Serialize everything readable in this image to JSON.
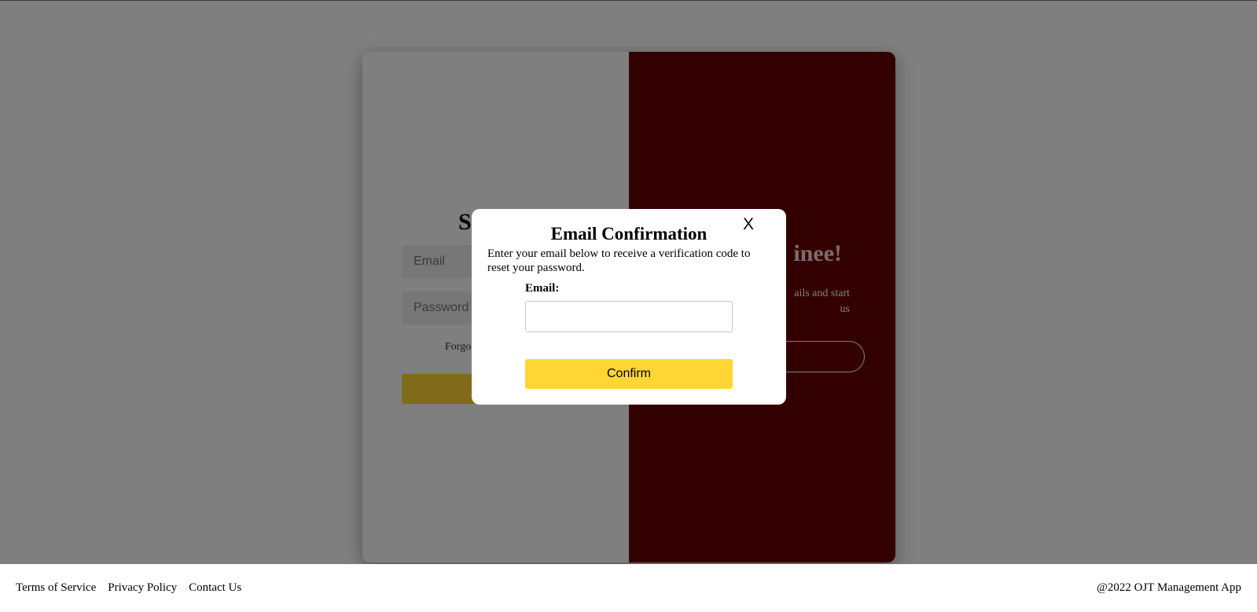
{
  "login": {
    "title": "S",
    "email_placeholder": "Email",
    "password_placeholder": "Password",
    "forgot_text": "Forgo",
    "signin_label": "S"
  },
  "welcome": {
    "title": "inee!",
    "text_line1": "ails and start",
    "text_line2": "us"
  },
  "modal": {
    "close_label": "X",
    "title": "Email Confirmation",
    "description": "Enter your email below to receive a verification code to reset your password.",
    "email_label": "Email:",
    "email_value": "",
    "confirm_label": "Confirm"
  },
  "footer": {
    "links": [
      "Terms of Service",
      "Privacy Policy",
      "Contact Us"
    ],
    "copyright": "@2022 OJT Management App"
  },
  "colors": {
    "accent_yellow": "#ffd633",
    "brand_maroon": "#670000",
    "overlay": "rgba(0,0,0,0.5)"
  }
}
